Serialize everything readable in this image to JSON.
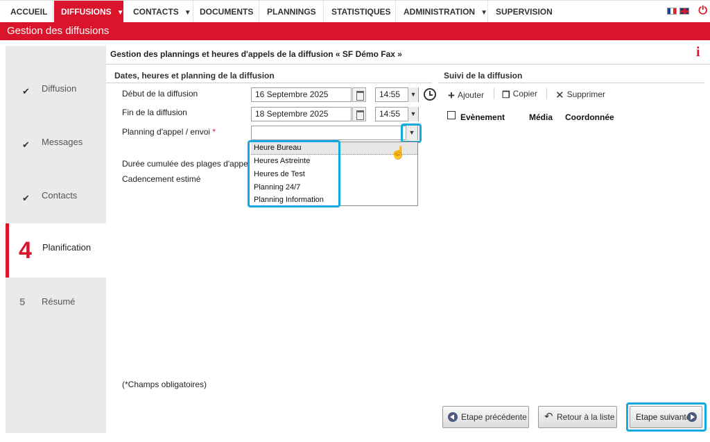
{
  "nav": {
    "items": [
      {
        "label": "ACCUEIL"
      },
      {
        "label": "DIFFUSIONS"
      },
      {
        "label": "CONTACTS"
      },
      {
        "label": "DOCUMENTS"
      },
      {
        "label": "PLANNINGS"
      },
      {
        "label": "STATISTIQUES"
      },
      {
        "label": "ADMINISTRATION"
      },
      {
        "label": "SUPERVISION"
      }
    ],
    "active": "DIFFUSIONS",
    "caret": "▼",
    "icons": [
      "flag-fr-icon",
      "flag-uk-icon",
      "power-icon"
    ]
  },
  "page_bar": {
    "title": "Gestion des diffusions"
  },
  "sidebar": {
    "steps": [
      {
        "mark": "✔",
        "label": "Diffusion"
      },
      {
        "mark": "✔",
        "label": "Messages"
      },
      {
        "mark": "✔",
        "label": "Contacts"
      },
      {
        "mark": "4",
        "label": "Planification"
      },
      {
        "mark": "5",
        "label": "Résumé"
      }
    ]
  },
  "main": {
    "heading": "Gestion des plannings et heures d'appels de la diffusion « SF Démo Fax »",
    "info_icon": "i",
    "section_left": "Dates, heures et planning de la diffusion",
    "section_right": "Suivi de la diffusion",
    "fields": {
      "start_label": "Début de la diffusion",
      "start_date": "16 Septembre 2025",
      "start_time": "14:55",
      "end_label": "Fin de la diffusion",
      "end_date": "18 Septembre 2025",
      "end_time": "14:55",
      "planning_label": "Planning d'appel / envoi",
      "required_mark": "*",
      "planning_value": "",
      "duration_label": "Durée cumulée des plages d'appels",
      "cadence_label": "Cadencement estimé"
    },
    "dropdown_options": [
      "Heure Bureau",
      "Heures Astreinte",
      "Heures de Test",
      "Planning 24/7",
      "Planning Information"
    ],
    "toolbar": {
      "add": "Ajouter",
      "copy": "Copier",
      "delete": "Supprimer"
    },
    "table_headers": {
      "event": "Evènement",
      "media": "Média",
      "coords": "Coordonnée"
    },
    "required_note": "(*Champs obligatoires)",
    "buttons": {
      "prev": "Etape précédente",
      "back": "Retour à la liste",
      "next": "Etape suivante"
    },
    "accent_color": "#d9142b",
    "highlight_color": "#14a9e0"
  }
}
